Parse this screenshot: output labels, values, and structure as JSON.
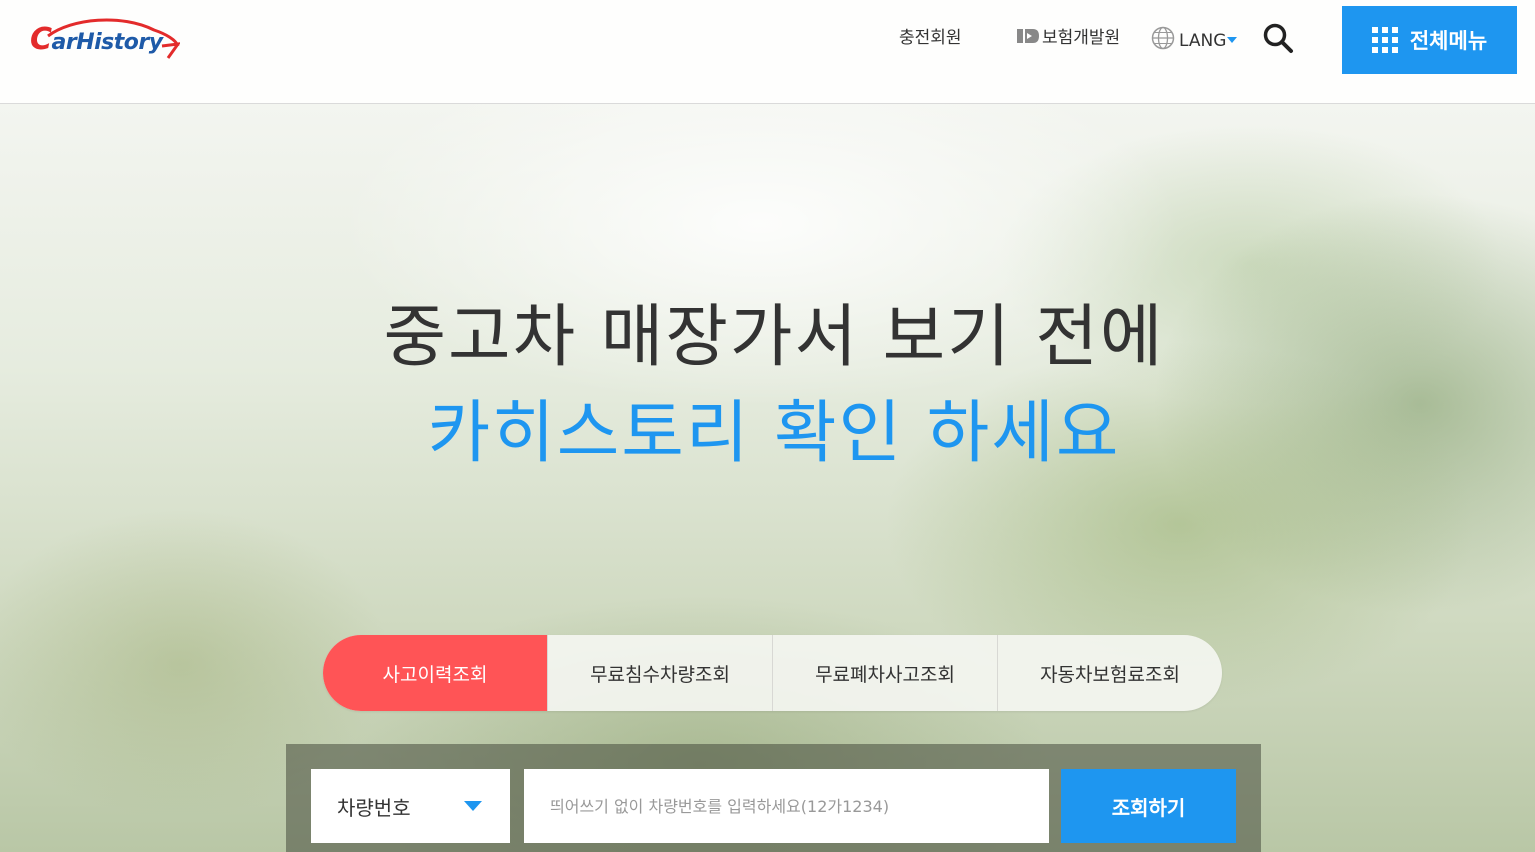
{
  "header": {
    "logo": {
      "first_letter": "C",
      "rest": "arHistory"
    },
    "nav": {
      "join_label": "충전회원",
      "kidi_label": "보험개발원",
      "lang_label": "LANG"
    },
    "menu_label": "전체메뉴",
    "icons": [
      "globe-icon",
      "search-icon",
      "grid-icon",
      "caret-down-icon"
    ]
  },
  "hero": {
    "line1": "중고차 매장가서 보기 전에",
    "line2": "카히스토리 확인 하세요"
  },
  "tabs": [
    {
      "label": "사고이력조회",
      "active": true
    },
    {
      "label": "무료침수차량조회",
      "active": false
    },
    {
      "label": "무료폐차사고조회",
      "active": false
    },
    {
      "label": "자동차보험료조회",
      "active": false
    }
  ],
  "search": {
    "select_value": "차량번호",
    "placeholder": "띄어쓰기 없이 차량번호를 입력하세요(12가1234)",
    "value": "",
    "submit_label": "조회하기"
  },
  "colors": {
    "accent": "#1e96f0",
    "active_tab": "#ff5456",
    "logo_red": "#e32b2b",
    "logo_blue": "#1e5aa8"
  }
}
